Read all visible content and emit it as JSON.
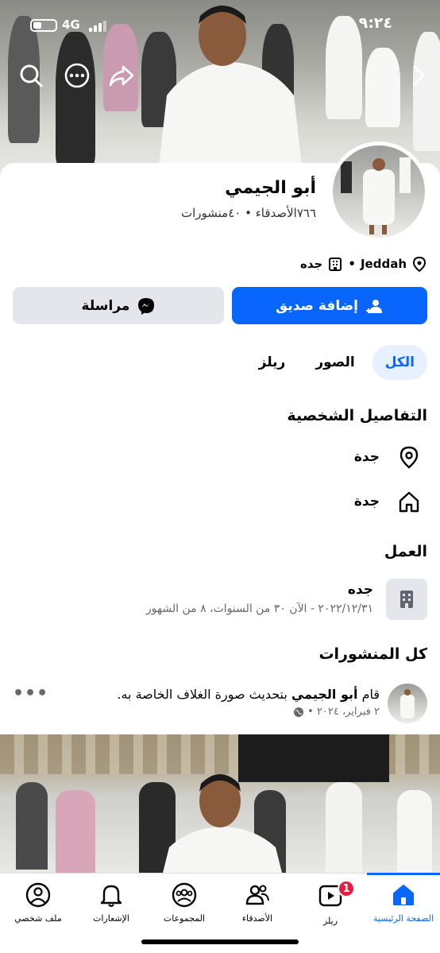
{
  "status_bar": {
    "time": "٩:٢٤",
    "network": "4G"
  },
  "profile": {
    "name": "أبو الجيمي",
    "stats": "٧٦٦الأصدقاء • ٤٠منشورات",
    "location_city": "Jeddah",
    "location_work": "جده"
  },
  "actions": {
    "add_friend": "إضافة صديق",
    "message": "مراسلة"
  },
  "tabs": [
    {
      "label": "الكل",
      "active": true
    },
    {
      "label": "الصور"
    },
    {
      "label": "ريلز"
    }
  ],
  "details": {
    "title": "التفاصيل الشخصية",
    "current_city": "جدة",
    "hometown": "جدة"
  },
  "work": {
    "title": "العمل",
    "name": "جده",
    "dates": "٢٠٢٢/١٢/٣١ - الآن ٣٠ من السنوات، ٨ من الشهور"
  },
  "posts": {
    "title": "كل المنشورات",
    "item": {
      "prefix": "قام ",
      "author": "أبو الجيمي",
      "text": " بتحديث صورة الغلاف الخاصة به.",
      "date": "٢ فبراير، ٢٠٢٤ •",
      "more": "•••"
    }
  },
  "bottom_nav": {
    "home": "الصفحة الرئيسية",
    "reels": "ريلز",
    "reels_badge": "1",
    "friends": "الأصدقاء",
    "groups": "المجموعات",
    "notifications": "الإشعارات",
    "profile": "ملف شخصي"
  },
  "colors": {
    "accent": "#0866ff",
    "badge": "#e41e3f",
    "secondary_button": "#e4e6eb"
  },
  "icons": [
    "search-icon",
    "more-icon",
    "share-icon",
    "chevron-right-icon",
    "location-pin-icon",
    "building-icon",
    "add-friend-icon",
    "messenger-icon",
    "home-icon",
    "reels-icon",
    "friends-icon",
    "groups-icon",
    "bell-icon",
    "profile-icon",
    "globe-icon"
  ]
}
